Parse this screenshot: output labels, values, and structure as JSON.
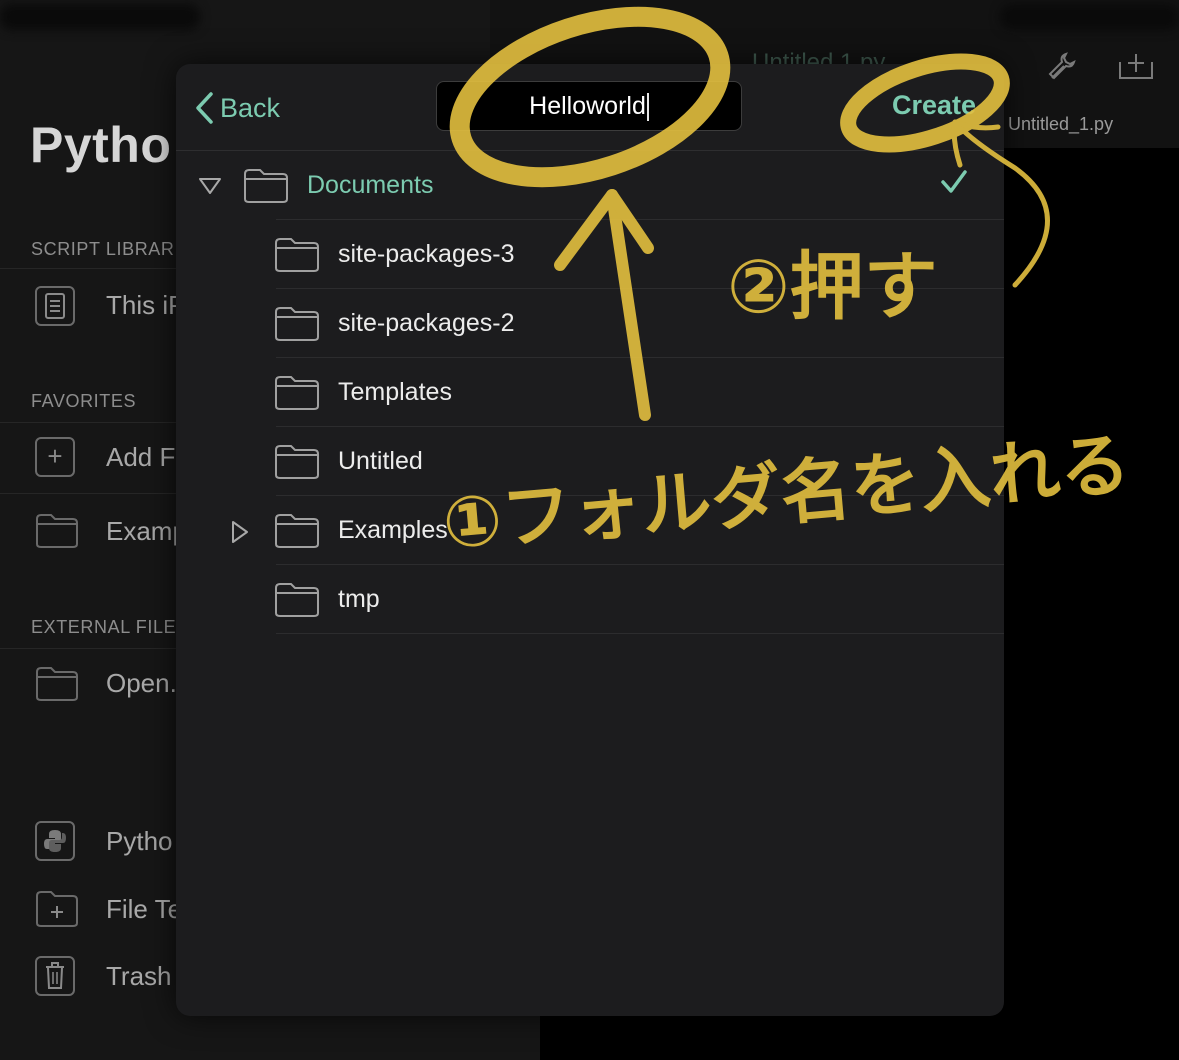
{
  "background": {
    "sidebar_title": "Pytho",
    "sections": [
      "SCRIPT LIBRAR",
      "FAVORITES",
      "EXTERNAL FILE"
    ],
    "items": [
      "This iP",
      "Add Fa",
      "Examp",
      "Open.",
      "Pytho",
      "File Te",
      "Trash"
    ],
    "editor_tab": "Untitled_1.py",
    "editor_tab_faded": "Untitled 1.py"
  },
  "sheet": {
    "back_label": "Back",
    "folder_name_value": "Helloworld",
    "create_label": "Create",
    "root_folder": "Documents",
    "folders": [
      "site-packages-3",
      "site-packages-2",
      "Templates",
      "Untitled",
      "Examples",
      "tmp"
    ]
  },
  "colors": {
    "accent": "#7ccbb0",
    "annotation": "#e3bf3f"
  },
  "annotations": {
    "step1": "①フォルダ名を入れる",
    "step2": "②押す"
  }
}
